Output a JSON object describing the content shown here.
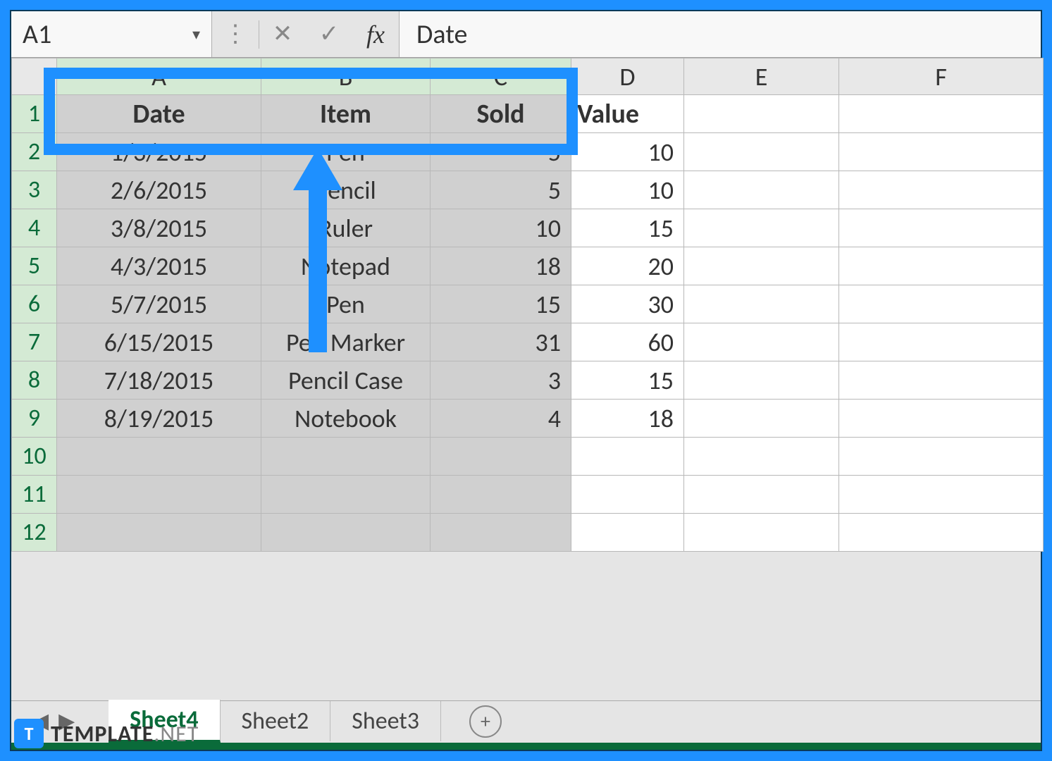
{
  "formula_bar": {
    "name_box": "A1",
    "dropdown_glyph": "▾",
    "separator_glyph": "⋮",
    "cancel_glyph": "✕",
    "enter_glyph": "✓",
    "fx_label": "fx",
    "content": "Date"
  },
  "columns": [
    "A",
    "B",
    "C",
    "D",
    "E",
    "F"
  ],
  "row_numbers": [
    "1",
    "2",
    "3",
    "4",
    "5",
    "6",
    "7",
    "8",
    "9",
    "10",
    "11",
    "12"
  ],
  "headers": {
    "a": "Date",
    "b": "Item",
    "c": "Sold",
    "d": "Value"
  },
  "rows": [
    {
      "date": "1/3/2015",
      "item": "Pen",
      "sold": "5",
      "value": "10"
    },
    {
      "date": "2/6/2015",
      "item": "Pencil",
      "sold": "5",
      "value": "10"
    },
    {
      "date": "3/8/2015",
      "item": "Ruler",
      "sold": "10",
      "value": "15"
    },
    {
      "date": "4/3/2015",
      "item": "Notepad",
      "sold": "18",
      "value": "20"
    },
    {
      "date": "5/7/2015",
      "item": "Pen",
      "sold": "15",
      "value": "30"
    },
    {
      "date": "6/15/2015",
      "item": "Pen Marker",
      "sold": "31",
      "value": "60"
    },
    {
      "date": "7/18/2015",
      "item": "Pencil Case",
      "sold": "3",
      "value": "15"
    },
    {
      "date": "8/19/2015",
      "item": "Notebook",
      "sold": "4",
      "value": "18"
    }
  ],
  "sheet_tabs": {
    "nav_prev": "◀",
    "nav_next": "▶",
    "tabs": [
      "Sheet4",
      "Sheet2",
      "Sheet3"
    ],
    "active": "Sheet4",
    "add_glyph": "+"
  },
  "watermark": {
    "badge": "T",
    "brand": "TEMPLATE",
    "suffix": ".NET"
  }
}
